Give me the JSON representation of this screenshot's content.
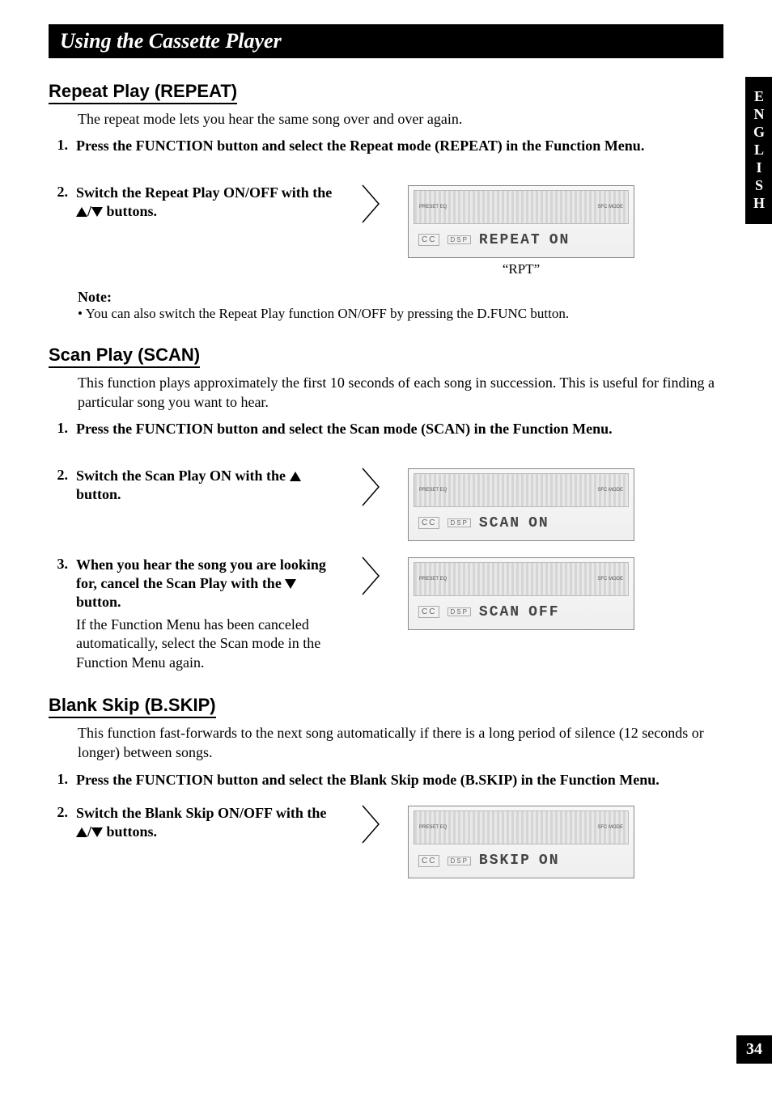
{
  "header": {
    "title": "Using the Cassette Player"
  },
  "sideTab": "ENGLISH",
  "pageNumber": "34",
  "repeat": {
    "title": "Repeat Play (REPEAT)",
    "intro": "The repeat mode lets you hear the same song over and over again.",
    "step1": "Press the FUNCTION button and select the Repeat mode (REPEAT) in the Function Menu.",
    "step2_a": "Switch the Repeat Play ON/OFF with the ",
    "step2_b": " buttons.",
    "display": {
      "cc": "CC",
      "dsp": "DSP",
      "text": "REPEAT",
      "state": "ON"
    },
    "caption": "“RPT”",
    "noteTitle": "Note:",
    "noteItem": "You can also switch the Repeat Play function ON/OFF by pressing the D.FUNC button."
  },
  "scan": {
    "title": "Scan Play (SCAN)",
    "intro": "This function plays approximately the first 10 seconds of each song in succession. This is useful for finding a particular song you want to hear.",
    "step1": "Press the FUNCTION button and select the Scan mode (SCAN) in the Function Menu.",
    "step2_a": "Switch the Scan Play ON with the ",
    "step2_b": " button.",
    "displayOn": {
      "cc": "CC",
      "dsp": "DSP",
      "text": "SCAN",
      "state": "ON"
    },
    "step3_a": "When you hear the song you are looking for, cancel the Scan Play with the ",
    "step3_b": " button.",
    "step3_sub": "If the Function Menu has been canceled automatically, select the Scan mode in the Function Menu again.",
    "displayOff": {
      "cc": "CC",
      "dsp": "DSP",
      "text": "SCAN",
      "state": "OFF"
    }
  },
  "bskip": {
    "title": "Blank Skip (B.SKIP)",
    "intro": "This function fast-forwards to the next song automatically if there is a long period of silence (12 seconds or longer) between songs.",
    "step1": "Press the FUNCTION button and select the Blank Skip mode (B.SKIP) in the Function Menu.",
    "step2_a": "Switch the Blank Skip ON/OFF with the ",
    "step2_b": " buttons.",
    "display": {
      "cc": "CC",
      "dsp": "DSP",
      "text": "BSKIP",
      "state": "ON"
    }
  }
}
